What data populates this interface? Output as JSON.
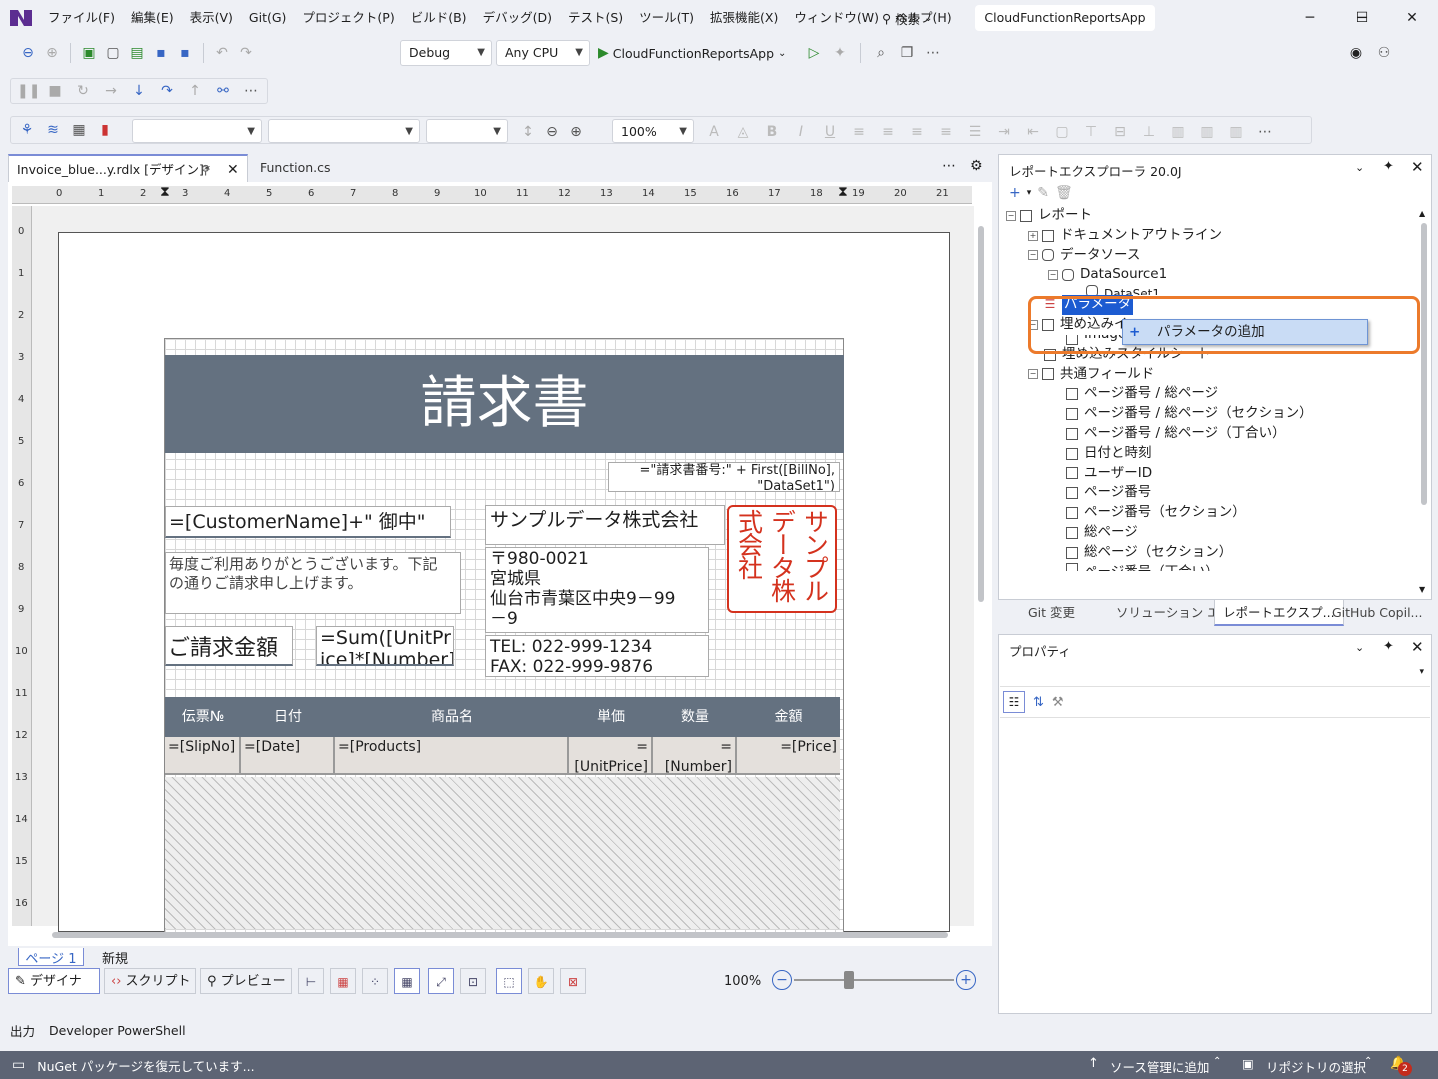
{
  "titlebar": {
    "menus": [
      "ファイル(F)",
      "編集(E)",
      "表示(V)",
      "Git(G)",
      "プロジェクト(P)",
      "ビルド(B)",
      "デバッグ(D)",
      "テスト(S)",
      "ツール(T)",
      "拡張機能(X)",
      "ウィンドウ(W)",
      "ヘルプ(H)"
    ],
    "search_label": "検索",
    "project_title": "CloudFunctionReportsApp",
    "minimize_icon": "─",
    "maximize_icon": "☐",
    "close_icon": "✕"
  },
  "toolbar1": {
    "config": "Debug",
    "platform": "Any CPU",
    "start_project": "CloudFunctionReportsApp"
  },
  "toolbar3": {
    "zoom": "100%"
  },
  "doctabs": {
    "invoice_tab": "Invoice_blue...y.rdlx [デザイン]*",
    "function_tab": "Function.cs",
    "more_icon": "⋯",
    "gear_icon": "⚙"
  },
  "ruler": {
    "h_numbers": [
      "0",
      "1",
      "2",
      "3",
      "4",
      "5",
      "6",
      "7",
      "8",
      "9",
      "10",
      "11",
      "12",
      "13",
      "14",
      "15",
      "16",
      "17",
      "18",
      "19",
      "20",
      "21"
    ],
    "v_numbers": [
      "0",
      "1",
      "2",
      "3",
      "4",
      "5",
      "6",
      "7",
      "8",
      "9",
      "10",
      "11",
      "12",
      "13",
      "14",
      "15",
      "16"
    ]
  },
  "report": {
    "title": "請求書",
    "bill_no_expr": "=\"請求書番号:\" + First([BillNo],",
    "bill_no_expr2": "\"DataSet1\")",
    "customer_expr": "=[CustomerName]+\" 御中\"",
    "greeting_line1": "毎度ご利用ありがとうございます。下記",
    "greeting_line2": "の通りご請求申し上げます。",
    "amount_label": "ご請求金額",
    "sum_expr1": "=Sum([UnitPr",
    "sum_expr2": "ice]*[Number]",
    "company_name": "サンプルデータ株式会社",
    "postal": "〒980-0021",
    "pref": "宮城県",
    "address1": "仙台市青葉区中央9－99",
    "address2": "－9",
    "tel": "TEL: 022-999-1234",
    "fax": "FAX: 022-999-9876",
    "seal_col1": "サンプル",
    "seal_col2": "データ株",
    "seal_col3": "式会社",
    "seal_color": "#d4321e",
    "header_color": "#647180",
    "table_headers": [
      "伝票№",
      "日付",
      "商品名",
      "単価",
      "数量",
      "金額"
    ],
    "table_cells": [
      "=[SlipNo]",
      "=[Date]",
      "=[Products]",
      "=[UnitPrice]",
      "=[Number]",
      "=[Price]"
    ]
  },
  "designer": {
    "page_tab": "ページ 1",
    "new_tab": "新規",
    "mode_design": "デザイナ",
    "mode_script": "スクリプト",
    "mode_preview": "プレビュー",
    "zoom": "100%"
  },
  "explorer": {
    "title": "レポートエクスプローラ 20.0J",
    "items": [
      {
        "label": "レポート",
        "indent": 0
      },
      {
        "label": "ドキュメントアウトライン",
        "indent": 1
      },
      {
        "label": "データソース",
        "indent": 1
      },
      {
        "label": "DataSource1",
        "indent": 2
      },
      {
        "label": "DataSet1",
        "indent": 3
      },
      {
        "label": "パラメータ",
        "indent": 1
      },
      {
        "label": "埋め込みイ",
        "indent": 1
      },
      {
        "label": "Image",
        "indent": 2
      },
      {
        "label": "埋め込みスタイルシート",
        "indent": 1
      },
      {
        "label": "共通フィールド",
        "indent": 1
      },
      {
        "label": "ページ番号 / 総ページ",
        "indent": 2
      },
      {
        "label": "ページ番号 / 総ページ（セクション）",
        "indent": 2
      },
      {
        "label": "ページ番号 / 総ページ（丁合い）",
        "indent": 2
      },
      {
        "label": "日付と時刻",
        "indent": 2
      },
      {
        "label": "ユーザーID",
        "indent": 2
      },
      {
        "label": "ページ番号",
        "indent": 2
      },
      {
        "label": "ページ番号（セクション）",
        "indent": 2
      },
      {
        "label": "総ページ",
        "indent": 2
      },
      {
        "label": "総ページ（セクション）",
        "indent": 2
      },
      {
        "label": "ページ番号（丁合い）",
        "indent": 2
      }
    ],
    "context_menu_item": "パラメータの追加",
    "context_menu_plus": "+",
    "highlight_color": "#ec7a2b"
  },
  "paneltabs": [
    "Git 変更",
    "ソリューション エ...",
    "レポートエクスプ...",
    "GitHub Copil..."
  ],
  "properties": {
    "title": "プロパティ"
  },
  "output": {
    "tab_output": "出力",
    "tab_powershell": "Developer PowerShell"
  },
  "statusbar": {
    "message": "NuGet パッケージを復元しています...",
    "source_control": "ソース管理に追加",
    "repository": "リポジトリの選択",
    "notification_count": "2"
  }
}
